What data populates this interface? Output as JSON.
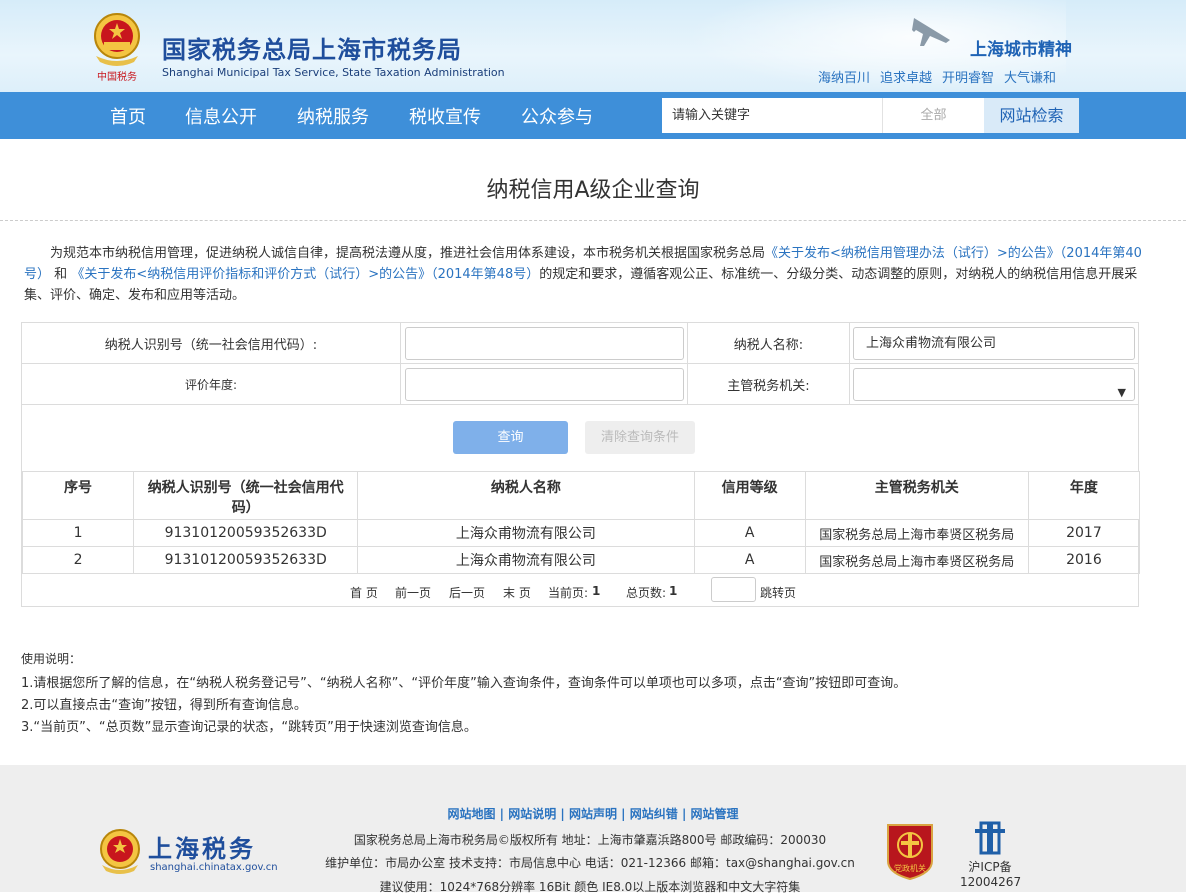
{
  "header": {
    "title": "国家税务总局上海市税务局",
    "subtitle": "Shanghai Municipal Tax Service, State Taxation Administration",
    "emblem_caption": "中国税务",
    "city_spirit": "上海城市精神",
    "slogans": [
      "海纳百川",
      "追求卓越",
      "开明睿智",
      "大气谦和"
    ]
  },
  "nav": {
    "items": [
      "首页",
      "信息公开",
      "纳税服务",
      "税收宣传",
      "公众参与"
    ],
    "search_placeholder": "请输入关键字",
    "search_scope": "全部",
    "search_button": "网站检索"
  },
  "page": {
    "title": "纳税信用A级企业查询",
    "intro": {
      "part1": "为规范本市纳税信用管理，促进纳税人诚信自律，提高税法遵从度，推进社会信用体系建设，本市税务机关根据国家税务总局",
      "link1": "《关于发布<纳税信用管理办法（试行）>的公告》（2014年第40号）",
      "part2": "和",
      "link2": "《关于发布<纳税信用评价指标和评价方式（试行）>的公告》（2014年第48号）",
      "part3": "的规定和要求，遵循客观公正、标准统一、分级分类、动态调整的原则，对纳税人的纳税信用信息开展采集、评价、确定、发布和应用等活动。"
    }
  },
  "form": {
    "taxpayer_id_label": "纳税人识别号（统一社会信用代码）:",
    "taxpayer_id_value": "",
    "taxpayer_name_label": "纳税人名称:",
    "taxpayer_name_value": "上海众甫物流有限公司",
    "year_label": "评价年度:",
    "year_value": "",
    "authority_label": "主管税务机关:",
    "authority_value": "",
    "query_button": "查询",
    "clear_button": "清除查询条件"
  },
  "results": {
    "columns": [
      "序号",
      "纳税人识别号（统一社会信用代码）",
      "纳税人名称",
      "信用等级",
      "主管税务机关",
      "年度"
    ],
    "rows": [
      [
        "1",
        "91310120059352633D",
        "上海众甫物流有限公司",
        "A",
        "国家税务总局上海市奉贤区税务局",
        "2017"
      ],
      [
        "2",
        "91310120059352633D",
        "上海众甫物流有限公司",
        "A",
        "国家税务总局上海市奉贤区税务局",
        "2016"
      ]
    ]
  },
  "pager": {
    "first": "首 页",
    "prev": "前一页",
    "next": "后一页",
    "last": "末 页",
    "current_label": "当前页:",
    "current": "1",
    "total_label": "总页数:",
    "total": "1",
    "jump_value": "",
    "jump_label": "跳转页"
  },
  "usage": {
    "heading": "使用说明：",
    "lines": [
      "1.请根据您所了解的信息，在“纳税人税务登记号”、“纳税人名称”、“评价年度”输入查询条件，查询条件可以单项也可以多项，点击“查询”按钮即可查询。",
      "2.可以直接点击“查询”按钮，得到所有查询信息。",
      "3.“当前页”、“总页数”显示查询记录的状态，“跳转页”用于快速浏览查询信息。"
    ]
  },
  "footer": {
    "links": [
      "网站地图",
      "网站说明",
      "网站声明",
      "网站纠错",
      "网站管理"
    ],
    "copyright": "国家税务总局上海市税务局©版权所有 地址：上海市肇嘉浜路800号 邮政编码：200030",
    "maintainer": "维护单位：市局办公室 技术支持：市局信息中心 电话：021-12366 邮箱：tax@shanghai.gov.cn",
    "suggestion": "建议使用：1024*768分辨率 16Bit 颜色 IE8.0以上版本浏览器和中文大字符集",
    "logo_text": "上海税务",
    "logo_url": "shanghai.chinatax.gov.cn",
    "badge_text": "党政机关",
    "icp_label": "沪ICP备",
    "icp_number": "12004267"
  },
  "colors": {
    "nav_bg": "#3e8fd9",
    "title_blue": "#1f4e9c",
    "link_blue": "#2a73c0",
    "query_button": "#7fb0ea",
    "emblem_red": "#c8161d"
  }
}
